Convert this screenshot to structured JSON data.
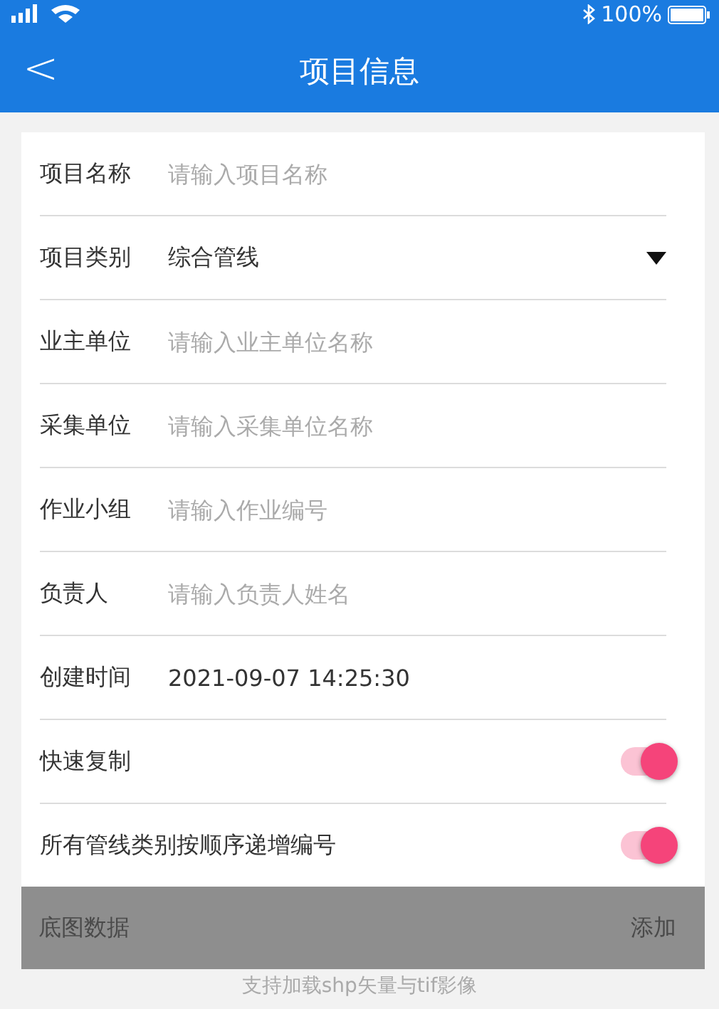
{
  "status_bar": {
    "battery": "100%"
  },
  "header": {
    "back": "<",
    "title": "项目信息"
  },
  "fields": [
    {
      "kind": "input",
      "label": "项目名称",
      "placeholder": "请输入项目名称"
    },
    {
      "kind": "select",
      "label": "项目类别",
      "value": "综合管线"
    },
    {
      "kind": "input",
      "label": "业主单位",
      "placeholder": "请输入业主单位名称"
    },
    {
      "kind": "input",
      "label": "采集单位",
      "placeholder": "请输入采集单位名称"
    },
    {
      "kind": "input",
      "label": "作业小组",
      "placeholder": "请输入作业编号"
    },
    {
      "kind": "input",
      "label": "负责人",
      "placeholder": "请输入负责人姓名"
    },
    {
      "kind": "text",
      "label": "创建时间",
      "value": "2021-09-07 14:25:30"
    },
    {
      "kind": "switch",
      "label": "快速复制",
      "on": true
    },
    {
      "kind": "switch",
      "label": "所有管线类别按顺序递增编号",
      "on": true
    }
  ],
  "basemap": {
    "label": "底图数据",
    "action": "添加",
    "hint": "支持加载shp矢量与tif影像"
  }
}
